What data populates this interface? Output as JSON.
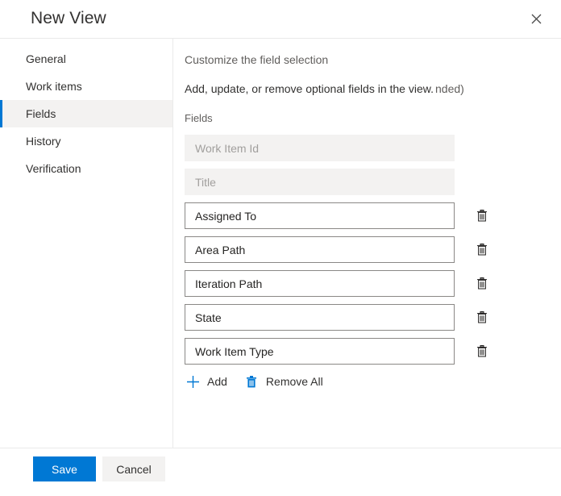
{
  "header": {
    "title": "New View",
    "close_icon": "close-icon"
  },
  "sidebar": {
    "items": [
      {
        "label": "General",
        "selected": false
      },
      {
        "label": "Work items",
        "selected": false
      },
      {
        "label": "Fields",
        "selected": true
      },
      {
        "label": "History",
        "selected": false
      },
      {
        "label": "Verification",
        "selected": false
      }
    ]
  },
  "main": {
    "section_title": "Customize the field selection",
    "section_description": "Add, update, or remove optional fields in the view.",
    "section_description_fragment": "nded)",
    "fields_label": "Fields",
    "fields": [
      {
        "value": "Work Item Id",
        "disabled": true,
        "deletable": false
      },
      {
        "value": "Title",
        "disabled": true,
        "deletable": false
      },
      {
        "value": "Assigned To",
        "disabled": false,
        "deletable": true
      },
      {
        "value": "Area Path",
        "disabled": false,
        "deletable": true
      },
      {
        "value": "Iteration Path",
        "disabled": false,
        "deletable": true
      },
      {
        "value": "State",
        "disabled": false,
        "deletable": true
      },
      {
        "value": "Work Item Type",
        "disabled": false,
        "deletable": true
      }
    ],
    "delete_icon": "trash-icon",
    "commands": {
      "add_label": "Add",
      "add_icon": "plus-icon",
      "remove_all_label": "Remove All",
      "remove_all_icon": "trash-filled-icon"
    }
  },
  "footer": {
    "save_label": "Save",
    "cancel_label": "Cancel"
  },
  "colors": {
    "accent": "#0078d4",
    "selected_background": "#f3f2f1",
    "border": "#8a8886",
    "divider": "#eaeaea",
    "text": "#323130",
    "muted_text": "#605e5c",
    "disabled_text": "#a19f9d"
  }
}
